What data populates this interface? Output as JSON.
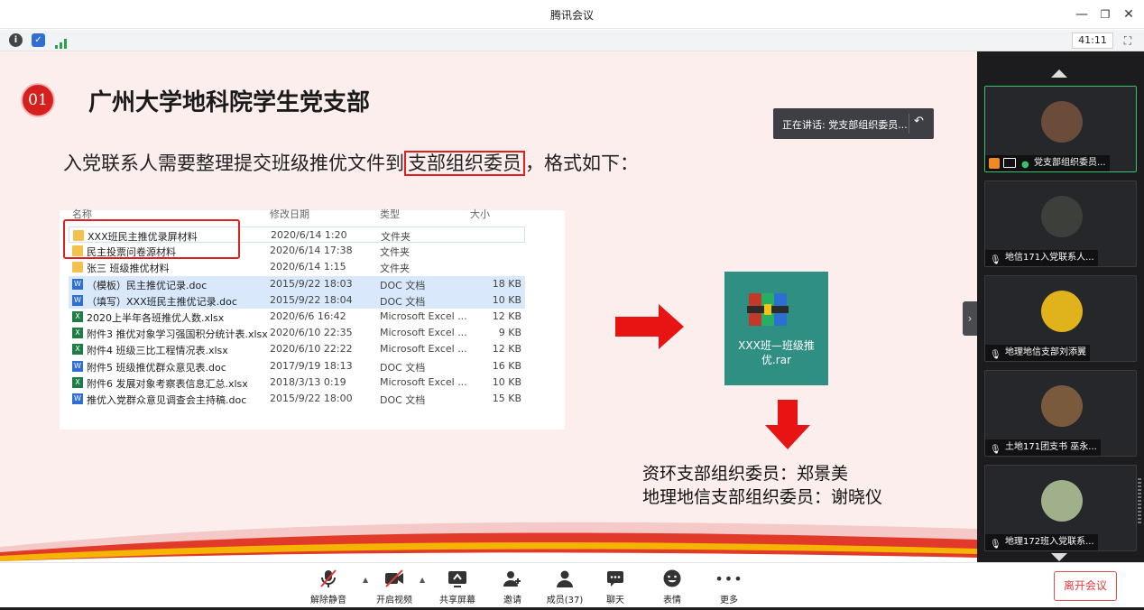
{
  "window": {
    "title": "腾讯会议",
    "timer": "41:11"
  },
  "slide": {
    "number": "01",
    "title": "广州大学地科院学生党支部",
    "instruction_before": "入党联系人需要整理提交班级推优文件到",
    "instruction_boxed": "支部组织委员",
    "instruction_after": "，格式如下：",
    "speaking": "正在讲话: 党支部组织委员...",
    "file_columns": [
      "名称",
      "修改日期",
      "类型",
      "大小"
    ],
    "files": [
      {
        "name": "XXX班民主推优录屏材料",
        "date": "2020/6/14 1:20",
        "type": "文件夹",
        "size": "",
        "icon": "folder-icon"
      },
      {
        "name": "民主投票问卷源材料",
        "date": "2020/6/14 17:38",
        "type": "文件夹",
        "size": "",
        "icon": "folder-icon"
      },
      {
        "name": "张三  班级推优材料",
        "date": "2020/6/14 1:15",
        "type": "文件夹",
        "size": "",
        "icon": "folder-icon"
      },
      {
        "name": "（模板）民主推优记录.doc",
        "date": "2015/9/22 18:03",
        "type": "DOC 文档",
        "size": "18 KB",
        "icon": "doc-icon"
      },
      {
        "name": "（填写）XXX班民主推优记录.doc",
        "date": "2015/9/22 18:04",
        "type": "DOC 文档",
        "size": "10 KB",
        "icon": "doc-icon"
      },
      {
        "name": "2020上半年各班推优人数.xlsx",
        "date": "2020/6/6 16:42",
        "type": "Microsoft Excel ...",
        "size": "12 KB",
        "icon": "excel-icon"
      },
      {
        "name": "附件3 推优对象学习强国积分统计表.xlsx",
        "date": "2020/6/10 22:35",
        "type": "Microsoft Excel ...",
        "size": "9 KB",
        "icon": "excel-icon"
      },
      {
        "name": "附件4 班级三比工程情况表.xlsx",
        "date": "2020/6/10 22:22",
        "type": "Microsoft Excel ...",
        "size": "12 KB",
        "icon": "excel-icon"
      },
      {
        "name": "附件5 班级推优群众意见表.doc",
        "date": "2017/9/19 18:13",
        "type": "DOC 文档",
        "size": "16 KB",
        "icon": "doc-icon"
      },
      {
        "name": "附件6 发展对象考察表信息汇总.xlsx",
        "date": "2018/3/13 0:19",
        "type": "Microsoft Excel ...",
        "size": "10 KB",
        "icon": "excel-icon"
      },
      {
        "name": "推优入党群众意见调查会主持稿.doc",
        "date": "2015/9/22 18:00",
        "type": "DOC 文档",
        "size": "15 KB",
        "icon": "doc-icon"
      }
    ],
    "rar_name": "XXX班—班级推优.rar",
    "committee": [
      "资环支部组织委员：郑景美",
      "地理地信支部组织委员：谢晓仪"
    ]
  },
  "participants": [
    {
      "name": "党支部组织委员...",
      "active": true,
      "avatar_color": "#6b4b3a"
    },
    {
      "name": "地信171入党联系人...",
      "active": false,
      "avatar_color": "#3c3f3a"
    },
    {
      "name": "地理地信支部刘添翼",
      "active": false,
      "avatar_color": "#e0b21c"
    },
    {
      "name": "土地171团支书 巫永...",
      "active": false,
      "avatar_color": "#7a5a3c"
    },
    {
      "name": "地理172班入党联系...",
      "active": false,
      "avatar_color": "#9fb08a"
    }
  ],
  "toolbar": {
    "unmute": "解除静音",
    "start_video": "开启视频",
    "share_screen": "共享屏幕",
    "invite": "邀请",
    "members": "成员(37)",
    "chat": "聊天",
    "emoji": "表情",
    "more": "更多",
    "leave": "离开会议"
  },
  "colors": {
    "accent_red": "#e02020",
    "slide_bg": "#fdeeee",
    "rar_tile": "#2f8f83",
    "panel_bg": "#1c1c1e",
    "active_border": "#39c16c"
  }
}
